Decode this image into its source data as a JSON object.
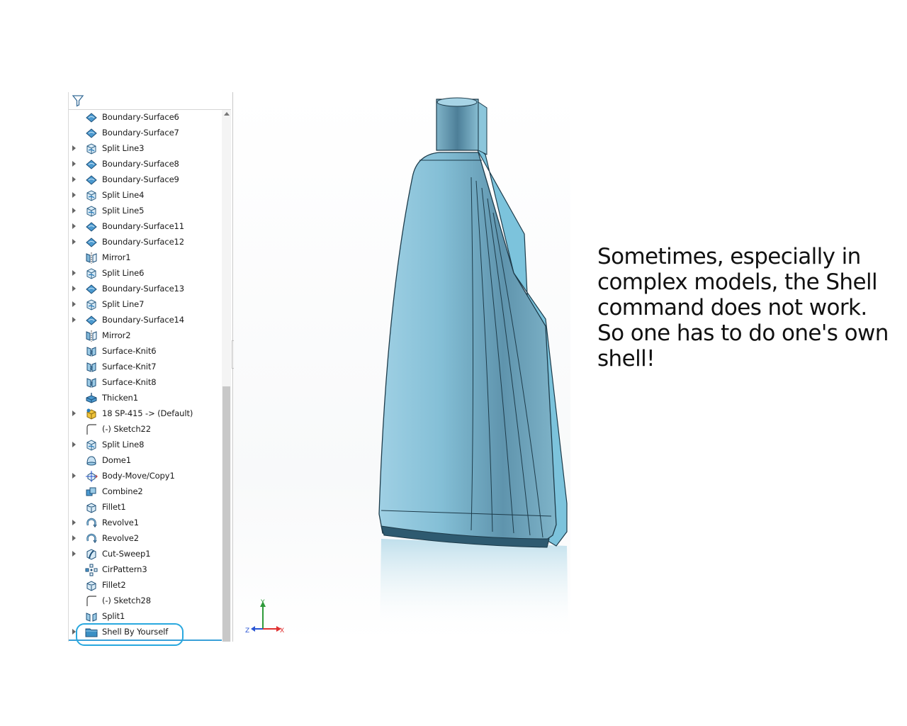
{
  "feature_tree": {
    "items": [
      {
        "label": "Boundary-Surface6",
        "icon": "boundary-surface-icon",
        "expandable": false
      },
      {
        "label": "Boundary-Surface7",
        "icon": "boundary-surface-icon",
        "expandable": false
      },
      {
        "label": "Split Line3",
        "icon": "split-line-icon",
        "expandable": true
      },
      {
        "label": "Boundary-Surface8",
        "icon": "boundary-surface-icon",
        "expandable": true
      },
      {
        "label": "Boundary-Surface9",
        "icon": "boundary-surface-icon",
        "expandable": true
      },
      {
        "label": "Split Line4",
        "icon": "split-line-icon",
        "expandable": true
      },
      {
        "label": "Split Line5",
        "icon": "split-line-icon",
        "expandable": true
      },
      {
        "label": "Boundary-Surface11",
        "icon": "boundary-surface-icon",
        "expandable": true
      },
      {
        "label": "Boundary-Surface12",
        "icon": "boundary-surface-icon",
        "expandable": true
      },
      {
        "label": "Mirror1",
        "icon": "mirror-icon",
        "expandable": false
      },
      {
        "label": "Split Line6",
        "icon": "split-line-icon",
        "expandable": true
      },
      {
        "label": "Boundary-Surface13",
        "icon": "boundary-surface-icon",
        "expandable": true
      },
      {
        "label": "Split Line7",
        "icon": "split-line-icon",
        "expandable": true
      },
      {
        "label": "Boundary-Surface14",
        "icon": "boundary-surface-icon",
        "expandable": true
      },
      {
        "label": "Mirror2",
        "icon": "mirror-icon",
        "expandable": false
      },
      {
        "label": "Surface-Knit6",
        "icon": "surface-knit-icon",
        "expandable": false
      },
      {
        "label": "Surface-Knit7",
        "icon": "surface-knit-icon",
        "expandable": false
      },
      {
        "label": "Surface-Knit8",
        "icon": "surface-knit-icon",
        "expandable": false
      },
      {
        "label": "Thicken1",
        "icon": "thicken-icon",
        "expandable": false
      },
      {
        "label": "18 SP-415 -> (Default)",
        "icon": "library-feature-icon",
        "expandable": true
      },
      {
        "label": "(-) Sketch22",
        "icon": "sketch-icon",
        "expandable": false
      },
      {
        "label": "Split Line8",
        "icon": "split-line-icon",
        "expandable": true
      },
      {
        "label": "Dome1",
        "icon": "dome-icon",
        "expandable": false
      },
      {
        "label": "Body-Move/Copy1",
        "icon": "move-copy-icon",
        "expandable": true
      },
      {
        "label": "Combine2",
        "icon": "combine-icon",
        "expandable": false
      },
      {
        "label": "Fillet1",
        "icon": "fillet-icon",
        "expandable": false
      },
      {
        "label": "Revolve1",
        "icon": "revolve-icon",
        "expandable": true
      },
      {
        "label": "Revolve2",
        "icon": "revolve-icon",
        "expandable": true
      },
      {
        "label": "Cut-Sweep1",
        "icon": "cut-sweep-icon",
        "expandable": true
      },
      {
        "label": "CirPattern3",
        "icon": "circular-pattern-icon",
        "expandable": false
      },
      {
        "label": "Fillet2",
        "icon": "fillet-icon",
        "expandable": false
      },
      {
        "label": "(-) Sketch28",
        "icon": "sketch-icon",
        "expandable": false
      },
      {
        "label": "Split1",
        "icon": "split-icon",
        "expandable": false
      },
      {
        "label": "Shell By Yourself",
        "icon": "folder-icon",
        "expandable": true
      }
    ],
    "highlighted_item": "Shell By Yourself"
  },
  "triad": {
    "y_label": "Y",
    "x_label": "X",
    "z_label": "Z"
  },
  "caption": "Sometimes, especially in complex models, the Shell command does not work. So one has to do one's own shell!",
  "colors": {
    "highlight_ring": "#29a8df",
    "model_body": "#7fb6cc",
    "icon_blue": "#3a8fc4",
    "axis_x": "#e03030",
    "axis_y": "#2f9a3a",
    "axis_z": "#2a55d4"
  }
}
